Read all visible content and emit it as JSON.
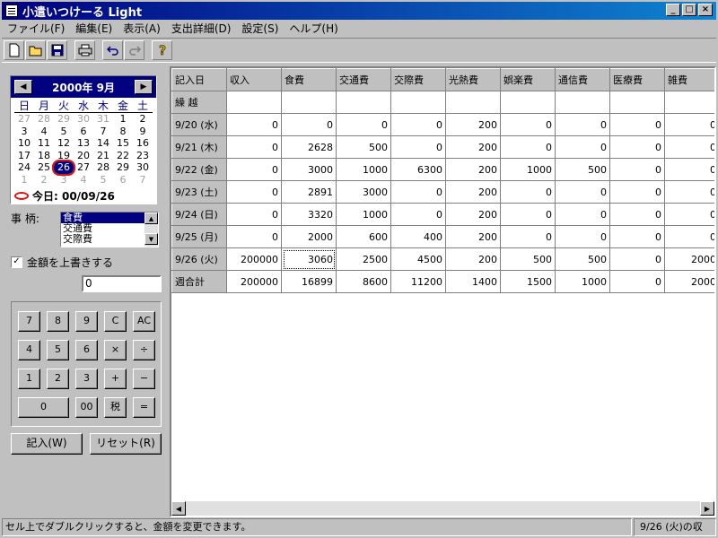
{
  "window": {
    "title": "小遣いつけーる Light",
    "buttons": [
      "_",
      "□",
      "×"
    ]
  },
  "menu": [
    "ファイル(F)",
    "編集(E)",
    "表示(A)",
    "支出詳細(D)",
    "設定(S)",
    "ヘルプ(H)"
  ],
  "toolbar": {
    "icons": [
      "new-file-icon",
      "open-folder-icon",
      "save-icon",
      "print-icon",
      "undo-icon",
      "redo-icon",
      "help-icon"
    ]
  },
  "calendar": {
    "title": "2000年 9月",
    "prev": "◀",
    "next": "▶",
    "weekdays": [
      "日",
      "月",
      "火",
      "水",
      "木",
      "金",
      "土"
    ],
    "days": [
      [
        "27",
        "other"
      ],
      [
        "28",
        "other"
      ],
      [
        "29",
        "other"
      ],
      [
        "30",
        "other"
      ],
      [
        "31",
        "other"
      ],
      [
        "1",
        ""
      ],
      [
        "2",
        ""
      ],
      [
        "3",
        ""
      ],
      [
        "4",
        ""
      ],
      [
        "5",
        ""
      ],
      [
        "6",
        ""
      ],
      [
        "7",
        ""
      ],
      [
        "8",
        ""
      ],
      [
        "9",
        ""
      ],
      [
        "10",
        ""
      ],
      [
        "11",
        ""
      ],
      [
        "12",
        ""
      ],
      [
        "13",
        ""
      ],
      [
        "14",
        ""
      ],
      [
        "15",
        ""
      ],
      [
        "16",
        ""
      ],
      [
        "17",
        ""
      ],
      [
        "18",
        ""
      ],
      [
        "19",
        ""
      ],
      [
        "20",
        ""
      ],
      [
        "21",
        ""
      ],
      [
        "22",
        ""
      ],
      [
        "23",
        ""
      ],
      [
        "24",
        ""
      ],
      [
        "25",
        ""
      ],
      [
        "26",
        "today"
      ],
      [
        "27",
        ""
      ],
      [
        "28",
        ""
      ],
      [
        "29",
        ""
      ],
      [
        "30",
        ""
      ],
      [
        "1",
        "other"
      ],
      [
        "2",
        "other"
      ],
      [
        "3",
        "other"
      ],
      [
        "4",
        "other"
      ],
      [
        "5",
        "other"
      ],
      [
        "6",
        "other"
      ],
      [
        "7",
        "other"
      ]
    ],
    "today_label": "今日: 00/09/26"
  },
  "item_label": "事 柄:",
  "items": [
    "食費",
    "交通費",
    "交際費"
  ],
  "overwrite_label": "金額を上書きする",
  "overwrite_checked": "✓",
  "amount_value": "0",
  "keypad": {
    "rows": [
      [
        "7",
        "8",
        "9",
        "C",
        "AC"
      ],
      [
        "4",
        "5",
        "6",
        "×",
        "÷"
      ],
      [
        "1",
        "2",
        "3",
        "+",
        "−"
      ]
    ],
    "last": [
      "0",
      "00",
      "税",
      "="
    ]
  },
  "buttons": {
    "enter": "記入(W)",
    "reset": "リセット(R)"
  },
  "grid": {
    "headers": [
      "記入日",
      "収入",
      "食費",
      "交通費",
      "交際費",
      "光熱費",
      "娯楽費",
      "通信費",
      "医療費",
      "雑費"
    ],
    "carry_label": "繰 越",
    "rows": [
      [
        "9/20 (水)",
        "0",
        "0",
        "0",
        "0",
        "200",
        "0",
        "0",
        "0",
        "0"
      ],
      [
        "9/21 (木)",
        "0",
        "2628",
        "500",
        "0",
        "200",
        "0",
        "0",
        "0",
        "0"
      ],
      [
        "9/22 (金)",
        "0",
        "3000",
        "1000",
        "6300",
        "200",
        "1000",
        "500",
        "0",
        "0"
      ],
      [
        "9/23 (土)",
        "0",
        "2891",
        "3000",
        "0",
        "200",
        "0",
        "0",
        "0",
        "0"
      ],
      [
        "9/24 (日)",
        "0",
        "3320",
        "1000",
        "0",
        "200",
        "0",
        "0",
        "0",
        "0"
      ],
      [
        "9/25 (月)",
        "0",
        "2000",
        "600",
        "400",
        "200",
        "0",
        "0",
        "0",
        "0"
      ],
      [
        "9/26 (火)",
        "200000",
        "3060",
        "2500",
        "4500",
        "200",
        "500",
        "500",
        "0",
        "2000"
      ]
    ],
    "total_label": "週合計",
    "totals": [
      "200000",
      "16899",
      "8600",
      "11200",
      "1400",
      "1500",
      "1000",
      "0",
      "2000"
    ]
  },
  "status": {
    "hint": "セル上でダブルクリックすると、金額を変更できます。",
    "info": "9/26 (火)の収"
  }
}
